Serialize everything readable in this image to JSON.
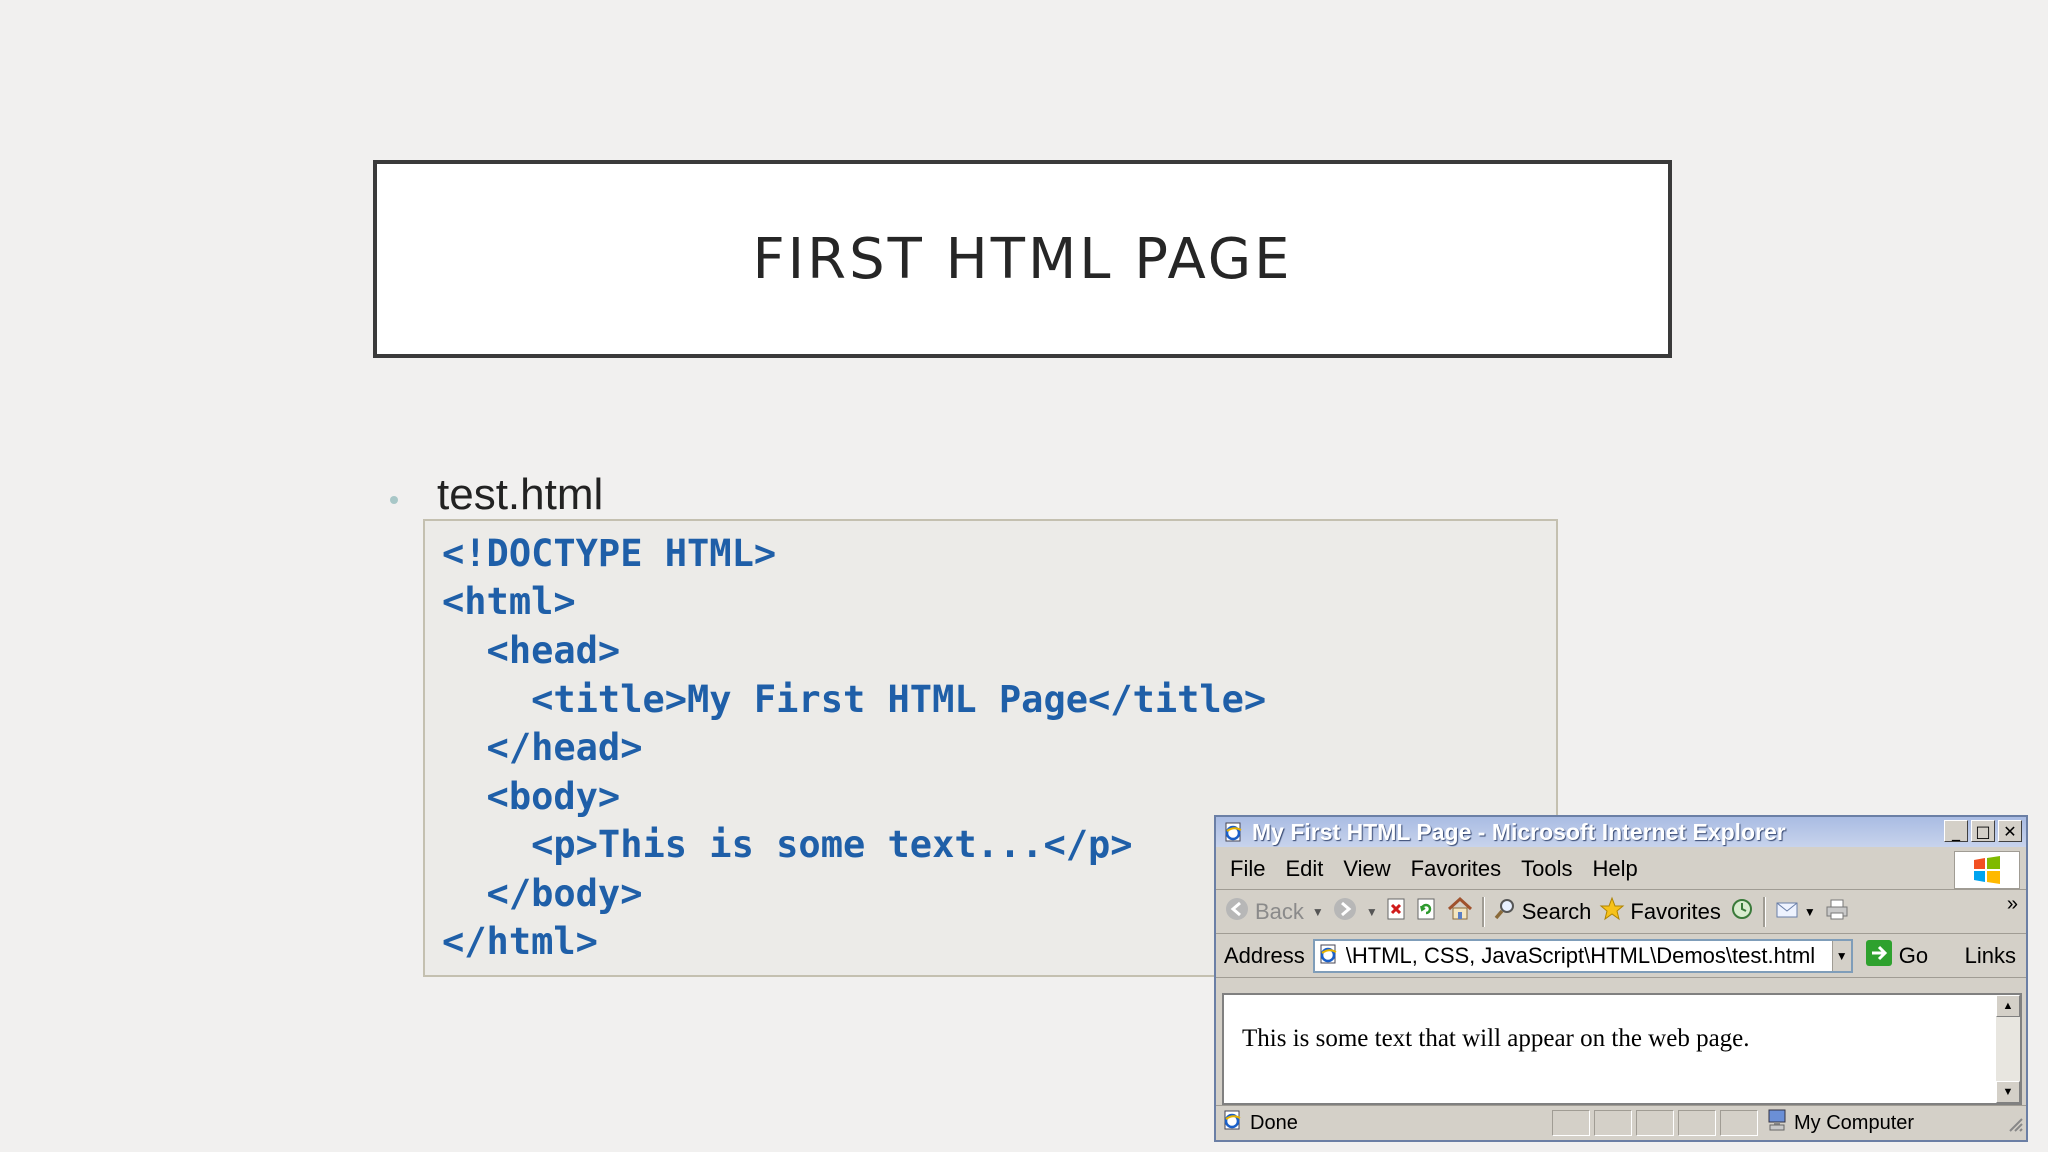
{
  "slide": {
    "title": "FIRST HTML PAGE",
    "bullet": "test.html",
    "code_lines": [
      "<!DOCTYPE HTML>",
      "<html>",
      "  <head>",
      "    <title>My First HTML Page</title>",
      "  </head>",
      "  <body>",
      "    <p>This is some text...</p>",
      "  </body>",
      "</html>"
    ]
  },
  "browser": {
    "title": "My First HTML Page - Microsoft Internet Explorer",
    "window_buttons": {
      "minimize": "_",
      "maximize": "□",
      "close": "✕"
    },
    "menu": [
      "File",
      "Edit",
      "View",
      "Favorites",
      "Tools",
      "Help"
    ],
    "toolbar": {
      "back": "Back",
      "search": "Search",
      "favorites": "Favorites",
      "more": "»"
    },
    "address_label": "Address",
    "address_value": "\\HTML, CSS, JavaScript\\HTML\\Demos\\test.html",
    "go_label": "Go",
    "links_label": "Links",
    "content_text": "This is some text that will appear on the web page.",
    "status_text": "Done",
    "zone_text": "My Computer"
  },
  "colors": {
    "slide_bg": "#f1f0ef",
    "code_text": "#1f5fa8",
    "titlebar": "#a9bce3"
  }
}
